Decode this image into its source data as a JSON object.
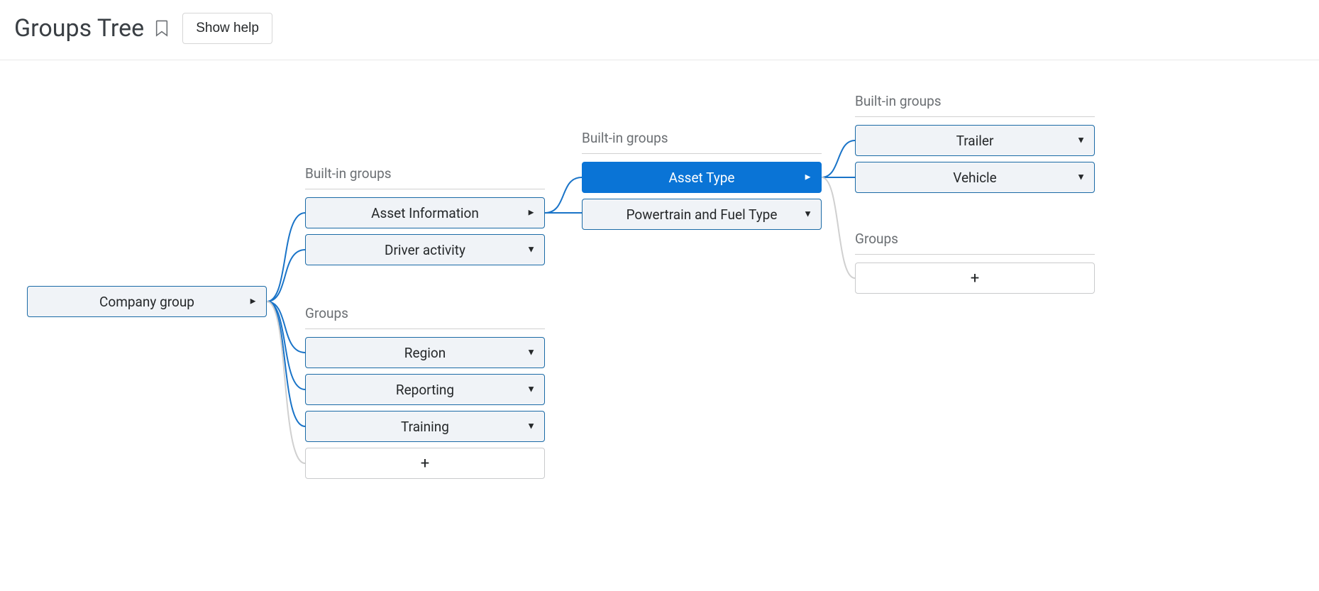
{
  "header": {
    "title": "Groups Tree",
    "showHelp": "Show help"
  },
  "level1": {
    "root": {
      "label": "Company group",
      "arrow": "►"
    }
  },
  "level2": {
    "builtinHeading": "Built-in groups",
    "groupsHeading": "Groups",
    "assetInfo": {
      "label": "Asset Information",
      "arrow": "►"
    },
    "driverAct": {
      "label": "Driver activity",
      "arrow": "▼"
    },
    "region": {
      "label": "Region",
      "arrow": "▼"
    },
    "reporting": {
      "label": "Reporting",
      "arrow": "▼"
    },
    "training": {
      "label": "Training",
      "arrow": "▼"
    },
    "add": {
      "label": "+"
    }
  },
  "level3": {
    "builtinHeading": "Built-in groups",
    "assetType": {
      "label": "Asset Type",
      "arrow": "►"
    },
    "powertrain": {
      "label": "Powertrain and Fuel Type",
      "arrow": "▼"
    }
  },
  "level4": {
    "builtinHeading": "Built-in groups",
    "groupsHeading": "Groups",
    "trailer": {
      "label": "Trailer",
      "arrow": "▼"
    },
    "vehicle": {
      "label": "Vehicle",
      "arrow": "▼"
    },
    "add": {
      "label": "+"
    }
  }
}
